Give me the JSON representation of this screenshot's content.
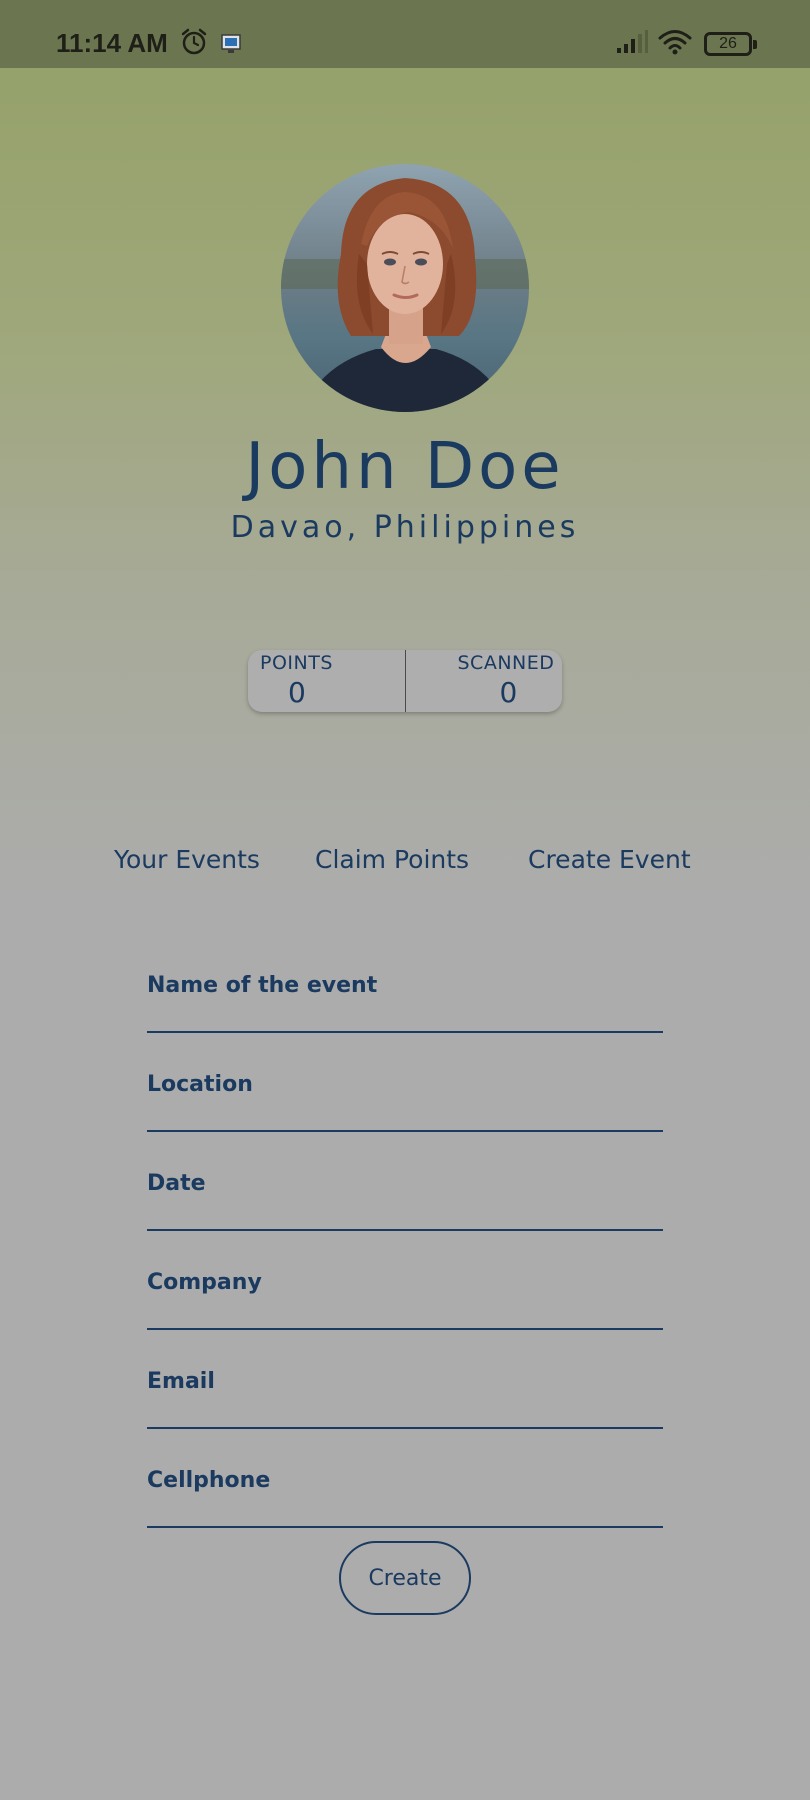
{
  "status_bar": {
    "time": "11:14 AM",
    "battery": "26",
    "icons": [
      "alarm-icon",
      "screen-icon",
      "signal-icon",
      "wifi-icon",
      "battery-icon"
    ]
  },
  "profile": {
    "name": "John Doe",
    "location": "Davao, Philippines",
    "avatar": "profile-photo"
  },
  "stats": {
    "points_label": "POINTS",
    "points_value": "0",
    "scanned_label": "SCANNED",
    "scanned_value": "0"
  },
  "tabs": [
    {
      "label": "Your Events"
    },
    {
      "label": "Claim Points"
    },
    {
      "label": "Create Event"
    }
  ],
  "form": {
    "fields": [
      {
        "label": "Name of the event",
        "value": ""
      },
      {
        "label": "Location",
        "value": ""
      },
      {
        "label": "Date",
        "value": ""
      },
      {
        "label": "Company",
        "value": ""
      },
      {
        "label": "Email",
        "value": ""
      },
      {
        "label": "Cellphone",
        "value": ""
      }
    ],
    "submit_label": "Create"
  },
  "colors": {
    "accent": "#1b3a60",
    "header_gradient_top": "#93a067",
    "background": "#acacac",
    "status_bar": "#6b7650"
  }
}
